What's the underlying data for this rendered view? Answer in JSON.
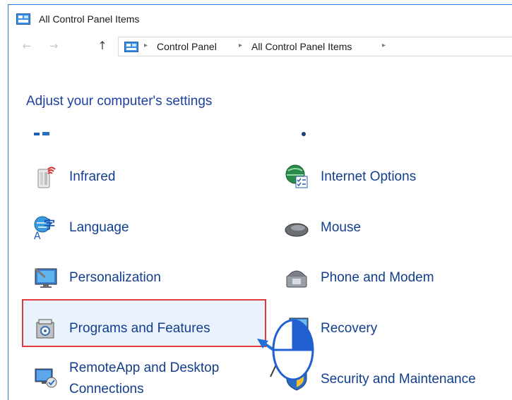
{
  "window": {
    "title": "All Control Panel Items"
  },
  "nav": {
    "back_icon": "arrow-left-icon",
    "forward_icon": "arrow-right-icon",
    "up_icon": "arrow-up-icon",
    "breadcrumb": [
      "Control Panel",
      "All Control Panel Items"
    ]
  },
  "heading": "Adjust your computer's settings",
  "items": [
    {
      "label": "Infrared",
      "icon": "infrared-icon"
    },
    {
      "label": "Internet Options",
      "icon": "internet-options-icon"
    },
    {
      "label": "Language",
      "icon": "language-icon"
    },
    {
      "label": "Mouse",
      "icon": "mouse-icon"
    },
    {
      "label": "Personalization",
      "icon": "personalization-icon"
    },
    {
      "label": "Phone and Modem",
      "icon": "phone-modem-icon"
    },
    {
      "label": "Programs and Features",
      "icon": "programs-features-icon"
    },
    {
      "label": "Recovery",
      "icon": "recovery-icon"
    },
    {
      "label": "RemoteApp and Desktop",
      "label2": "Connections",
      "icon": "remoteapp-icon"
    },
    {
      "label": "Security and Maintenance",
      "icon": "security-maintenance-icon"
    }
  ],
  "annotation": {
    "highlight_color": "#e23a3a",
    "arrow_color": "#1f6fd6"
  }
}
